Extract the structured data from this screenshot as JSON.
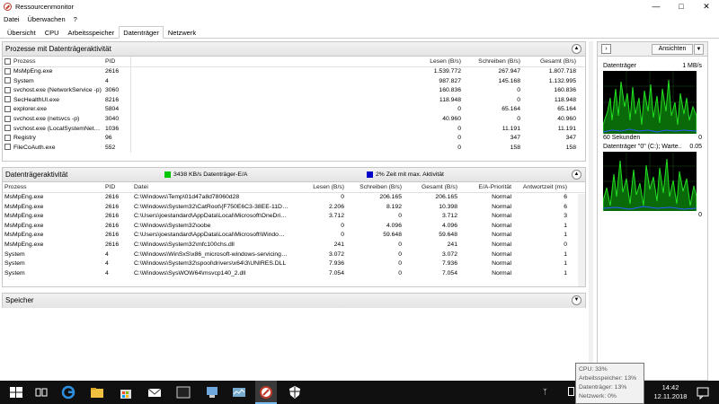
{
  "window": {
    "title": "Ressourcenmonitor"
  },
  "menu": [
    "Datei",
    "Überwachen",
    "?"
  ],
  "tabs": [
    "Übersicht",
    "CPU",
    "Arbeitsspeicher",
    "Datenträger",
    "Netzwerk"
  ],
  "processes": {
    "title": "Prozesse mit Datenträgeraktivität",
    "headers": [
      "Prozess",
      "PID",
      "Lesen (B/s)",
      "Schreiben (B/s)",
      "Gesamt (B/s)"
    ],
    "rows": [
      [
        "MsMpEng.exe",
        "2616",
        "1.539.772",
        "267.947",
        "1.807.718"
      ],
      [
        "System",
        "4",
        "987.827",
        "145.168",
        "1.132.995"
      ],
      [
        "svchost.exe (NetworkService -p)",
        "3060",
        "160.836",
        "0",
        "160.836"
      ],
      [
        "SecHealthUI.exe",
        "8216",
        "118.948",
        "0",
        "118.948"
      ],
      [
        "explorer.exe",
        "5804",
        "0",
        "65.164",
        "65.164"
      ],
      [
        "svchost.exe (netsvcs -p)",
        "3040",
        "40.960",
        "0",
        "40.960"
      ],
      [
        "svchost.exe (LocalSystemNetwo...",
        "1036",
        "0",
        "11.191",
        "11.191"
      ],
      [
        "Registry",
        "96",
        "0",
        "347",
        "347"
      ],
      [
        "FileCoAuth.exe",
        "552",
        "0",
        "158",
        "158"
      ]
    ]
  },
  "activity": {
    "title": "Datenträgeraktivität",
    "legend1": "3438 KB/s Datenträger-E/A",
    "legend2": "2% Zeit mit max. Aktivität",
    "color1": "#00c800",
    "color2": "#0000c8",
    "headers": [
      "Prozess",
      "PID",
      "Datei",
      "Lesen (B/s)",
      "Schreiben (B/s)",
      "Gesamt (B/s)",
      "E/A-Priorität",
      "Antwortzeit (ms)"
    ],
    "rows": [
      [
        "MsMpEng.exe",
        "2616",
        "C:\\Windows\\Temp\\01d47a8d78060d28",
        "0",
        "206.165",
        "206.165",
        "Normal",
        "6"
      ],
      [
        "MsMpEng.exe",
        "2616",
        "C:\\Windows\\System32\\CatRoot\\{F750E6C3-38EE-11D1-8...",
        "2.206",
        "8.192",
        "10.398",
        "Normal",
        "6"
      ],
      [
        "MsMpEng.exe",
        "2616",
        "C:\\Users\\joestandard\\AppData\\Local\\Microsoft\\OneDrive\\...",
        "3.712",
        "0",
        "3.712",
        "Normal",
        "3"
      ],
      [
        "MsMpEng.exe",
        "2616",
        "C:\\Windows\\System32\\oobe",
        "0",
        "4.096",
        "4.096",
        "Normal",
        "1"
      ],
      [
        "MsMpEng.exe",
        "2616",
        "C:\\Users\\joestandard\\AppData\\Local\\Microsoft\\Windows\\...",
        "0",
        "59.648",
        "59.648",
        "Normal",
        "1"
      ],
      [
        "MsMpEng.exe",
        "2616",
        "C:\\Windows\\System32\\mfc100chs.dll",
        "241",
        "0",
        "241",
        "Normal",
        "0"
      ],
      [
        "System",
        "4",
        "C:\\Windows\\WinSxS\\x86_microsoft-windows-servicingstac...",
        "3.072",
        "0",
        "3.072",
        "Normal",
        "1"
      ],
      [
        "System",
        "4",
        "C:\\Windows\\System32\\spool\\drivers\\x64\\3\\UNIRES.DLL",
        "7.936",
        "0",
        "7.936",
        "Normal",
        "1"
      ],
      [
        "System",
        "4",
        "C:\\Windows\\SysWOW64\\msvcp140_2.dll",
        "7.054",
        "0",
        "7.054",
        "Normal",
        "1"
      ]
    ]
  },
  "memory": {
    "title": "Speicher"
  },
  "right": {
    "views_label": "Ansichten",
    "graph1": {
      "label": "Datenträger",
      "scale": "1 MB/s",
      "bottom_left": "60 Sekunden",
      "bottom_right": "0"
    },
    "graph2": {
      "label": "Datenträger \"0\" (C:); Warte...",
      "scale": "0.05",
      "bottom_right": "0"
    }
  },
  "taskbar": {
    "time": "14:42",
    "date": "12.11.2018"
  },
  "tooltip": {
    "lines": [
      "CPU: 33%",
      "Arbeitsspeicher: 13%",
      "Datenträger: 13%",
      "Netzwerk: 0%"
    ]
  }
}
